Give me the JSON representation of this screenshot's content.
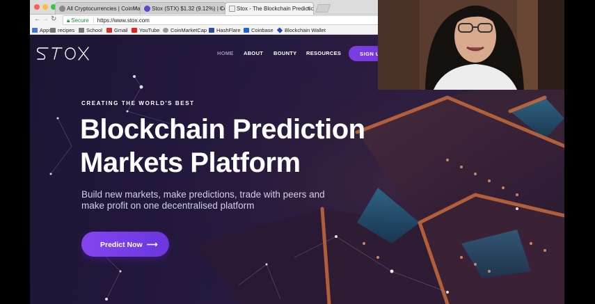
{
  "browser": {
    "tabs": [
      {
        "title": "All Cryptocurrencies | CoinMa",
        "active": false,
        "favicon_color": "#888888"
      },
      {
        "title": "Stox (STX) $1.32 (9.12%) | Co",
        "active": false,
        "favicon_color": "#5b49c9"
      },
      {
        "title": "Stox - The Blockchain Predictio",
        "active": true,
        "favicon_color": "#eeeeee"
      }
    ],
    "secure_label": "Secure",
    "url": "https://www.stox.com",
    "bookmarks": [
      {
        "label": "Apps",
        "icon": "apps-grid-icon",
        "color": "#4a72d4"
      },
      {
        "label": "recipes",
        "icon": "folder-icon",
        "color": "#777777"
      },
      {
        "label": "School",
        "icon": "folder-icon",
        "color": "#777777"
      },
      {
        "label": "Gmail",
        "icon": "gmail-icon",
        "color": "#d93025"
      },
      {
        "label": "YouTube",
        "icon": "youtube-icon",
        "color": "#e62117"
      },
      {
        "label": "CoinMarketCap",
        "icon": "coinmarketcap-icon",
        "color": "#999999"
      },
      {
        "label": "HashFlare",
        "icon": "hashflare-icon",
        "color": "#2a4ea8"
      },
      {
        "label": "Coinbase",
        "icon": "coinbase-icon",
        "color": "#1f62d9"
      },
      {
        "label": "Blockchain Wallet",
        "icon": "blockchain-icon",
        "color": "#1f4fa8"
      }
    ]
  },
  "site": {
    "nav": [
      "HOME",
      "ABOUT",
      "BOUNTY",
      "RESOURCES"
    ],
    "signup_label": "SIGN U",
    "eyebrow": "CREATING THE WORLD'S BEST",
    "headline_line1": "Blockchain Prediction",
    "headline_line2": "Markets Platform",
    "sub_line1": "Build new markets, make predictions, trade with peers and",
    "sub_line2": "make profit on one decentralised platform",
    "cta_label": "Predict Now",
    "cta_arrow": "⟶"
  },
  "colors": {
    "accent": "#7b3fe4",
    "page_bg": "#1e1535",
    "secure": "#1e8e3e"
  }
}
